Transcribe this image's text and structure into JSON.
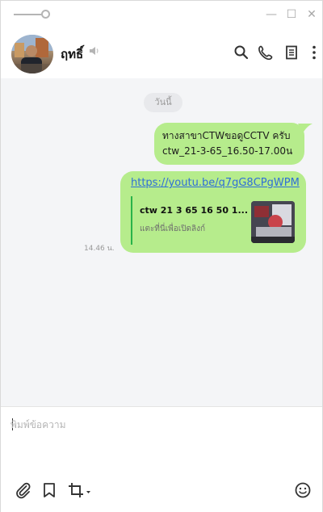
{
  "window": {
    "minimize_glyph": "—",
    "maximize_glyph": "☐",
    "close_glyph": "✕"
  },
  "header": {
    "contact_name": "ฤทธิ์",
    "icons": [
      "mute-icon",
      "search-icon",
      "call-icon",
      "notes-icon",
      "more-icon"
    ]
  },
  "chat": {
    "date_label": "วันนี้",
    "messages": [
      {
        "line1": "ทางสาขาCTWขอดูCCTV ครับ",
        "line2": "ctw_21-3-65_16.50-17.00น"
      },
      {
        "link": "https://youtu.be/q7gG8CPgWPM",
        "preview_title": "ctw 21 3 65 16 50 1...",
        "preview_subtitle": "แตะที่นี่เพื่อเปิดลิงก์"
      }
    ],
    "timestamp": "14.46 น."
  },
  "input": {
    "placeholder": "พิมพ์ข้อความ"
  },
  "toolbar": {
    "icons": [
      "paperclip-icon",
      "bookmark-icon",
      "crop-icon",
      "emoji-icon"
    ]
  },
  "colors": {
    "bubble": "#b6ec8c",
    "link": "#2f6fd6",
    "preview_bar": "#29b34a"
  }
}
